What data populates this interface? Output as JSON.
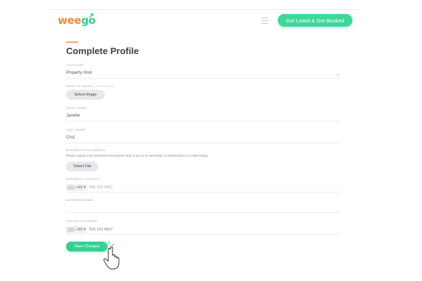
{
  "header": {
    "logo_part1": "wee",
    "logo_part2": "go",
    "cta_label": "Get Listed & Get Booked"
  },
  "page": {
    "title": "Complete Profile"
  },
  "form": {
    "category": {
      "label": "CATEGORY",
      "value": "Property Host"
    },
    "profile_image": {
      "label": "PROFILE IMAGE",
      "optional": "(OPTIONAL)",
      "button": "Select Image"
    },
    "first_name": {
      "label": "FIRST NAME",
      "value": "Janette"
    },
    "last_name": {
      "label": "LAST NAME",
      "value": "Cruz"
    },
    "business_documents": {
      "label": "BUSINESS DOCUMENTS",
      "hint": "Please upload your Business Document/s and/ or proof of ownership or authorization to create listing.",
      "button": "Select File"
    },
    "business_contact": {
      "label": "BUSINESS CONTACT",
      "code": "+63",
      "placeholder": "905 123 4567"
    },
    "business_name": {
      "label": "BUSINESS NAME",
      "value": ""
    },
    "contact_number": {
      "label": "CONTACT NUMBER",
      "code": "+63",
      "value": "915 123 4567"
    },
    "save_label": "Save Changes"
  },
  "colors": {
    "brand_orange": "#f08a3c",
    "brand_green": "#3ed79a",
    "button_gray": "#e8e8ec"
  }
}
